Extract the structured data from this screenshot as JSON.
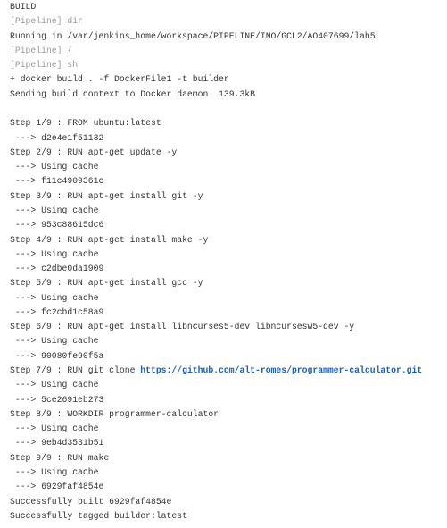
{
  "console": {
    "lines": [
      {
        "text": "BUILD",
        "kind": "normal"
      },
      {
        "text": "[Pipeline] dir",
        "kind": "pipeline"
      },
      {
        "text": "Running in /var/jenkins_home/workspace/PIPELINE/INO/GCL2/AO407699/lab5",
        "kind": "normal"
      },
      {
        "text": "[Pipeline] {",
        "kind": "pipeline"
      },
      {
        "text": "[Pipeline] sh",
        "kind": "pipeline"
      },
      {
        "text": "+ docker build . -f DockerFile1 -t builder",
        "kind": "normal"
      },
      {
        "text": "Sending build context to Docker daemon  139.3kB",
        "kind": "normal"
      },
      {
        "text": "",
        "kind": "normal"
      },
      {
        "text": "Step 1/9 : FROM ubuntu:latest",
        "kind": "normal"
      },
      {
        "text": " ---> d2e4e1f51132",
        "kind": "normal"
      },
      {
        "text": "Step 2/9 : RUN apt-get update -y",
        "kind": "normal"
      },
      {
        "text": " ---> Using cache",
        "kind": "normal"
      },
      {
        "text": " ---> f11c4909361c",
        "kind": "normal"
      },
      {
        "text": "Step 3/9 : RUN apt-get install git -y",
        "kind": "normal"
      },
      {
        "text": " ---> Using cache",
        "kind": "normal"
      },
      {
        "text": " ---> 953c88615dc6",
        "kind": "normal"
      },
      {
        "text": "Step 4/9 : RUN apt-get install make -y",
        "kind": "normal"
      },
      {
        "text": " ---> Using cache",
        "kind": "normal"
      },
      {
        "text": " ---> c2dbe0da1909",
        "kind": "normal"
      },
      {
        "text": "Step 5/9 : RUN apt-get install gcc -y",
        "kind": "normal"
      },
      {
        "text": " ---> Using cache",
        "kind": "normal"
      },
      {
        "text": " ---> fc2cbd1c58a9",
        "kind": "normal"
      },
      {
        "text": "Step 6/9 : RUN apt-get install libncurses5-dev libncursesw5-dev -y",
        "kind": "normal"
      },
      {
        "text": " ---> Using cache",
        "kind": "normal"
      },
      {
        "text": " ---> 90080fe90f5a",
        "kind": "normal"
      },
      {
        "text": "Step 7/9 : RUN git clone ",
        "kind": "link",
        "link": "https://github.com/alt-romes/programmer-calculator.git"
      },
      {
        "text": " ---> Using cache",
        "kind": "normal"
      },
      {
        "text": " ---> 5ce2691eb273",
        "kind": "normal"
      },
      {
        "text": "Step 8/9 : WORKDIR programmer-calculator",
        "kind": "normal"
      },
      {
        "text": " ---> Using cache",
        "kind": "normal"
      },
      {
        "text": " ---> 9eb4d3531b51",
        "kind": "normal"
      },
      {
        "text": "Step 9/9 : RUN make",
        "kind": "normal"
      },
      {
        "text": " ---> Using cache",
        "kind": "normal"
      },
      {
        "text": " ---> 6929faf4854e",
        "kind": "normal"
      },
      {
        "text": "Successfully built 6929faf4854e",
        "kind": "normal"
      },
      {
        "text": "Successfully tagged builder:latest",
        "kind": "normal"
      }
    ]
  },
  "colors": {
    "text": "#333333",
    "pipeline": "#9a9a9a",
    "link": "#1a5fb4"
  }
}
